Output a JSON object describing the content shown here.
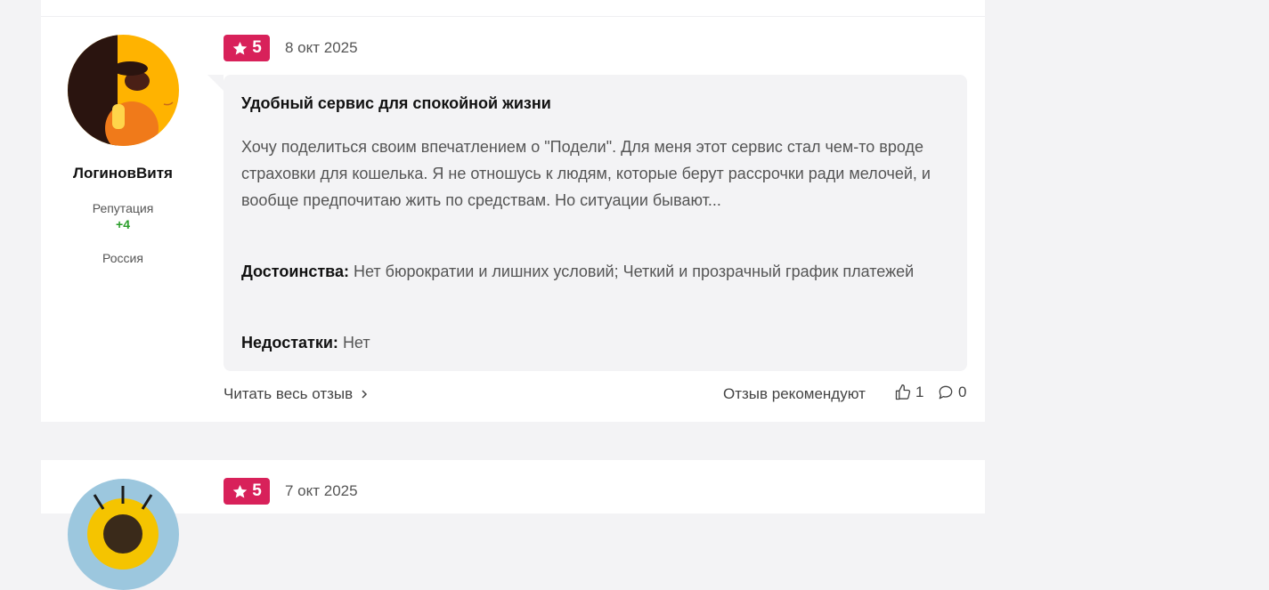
{
  "reviews": [
    {
      "author": "ЛогиновВитя",
      "reputation_label": "Репутация",
      "reputation_value": "+4",
      "country": "Россия",
      "rating": "5",
      "date": "8 окт 2025",
      "title": "Удобный сервис для спокойной жизни",
      "text": "Хочу поделиться своим впечатлением о \"Подели\". Для меня этот сервис стал чем-то вроде страховки для кошелька. Я не отношусь к людям, которые берут рассрочки ради мелочей, и вообще предпочитаю жить по средствам. Но ситуации бывают...",
      "pros_label": "Достоинства:",
      "pros": "Нет бюрократии и лишних условий; Четкий и прозрачный график платежей",
      "cons_label": "Недостатки:",
      "cons": "Нет",
      "read_more": "Читать весь отзыв",
      "recommend_label": "Отзыв рекомендуют",
      "likes": "1",
      "comments": "0"
    },
    {
      "rating": "5",
      "date": "7 окт 2025"
    }
  ],
  "icons": {
    "star": "star-icon",
    "chevron": "chevron-right-icon",
    "thumb": "thumbs-up-icon",
    "comment": "comment-icon"
  },
  "colors": {
    "rating_badge": "#d8215a",
    "reputation": "#2a9d2a",
    "bubble": "#f3f3f5"
  }
}
